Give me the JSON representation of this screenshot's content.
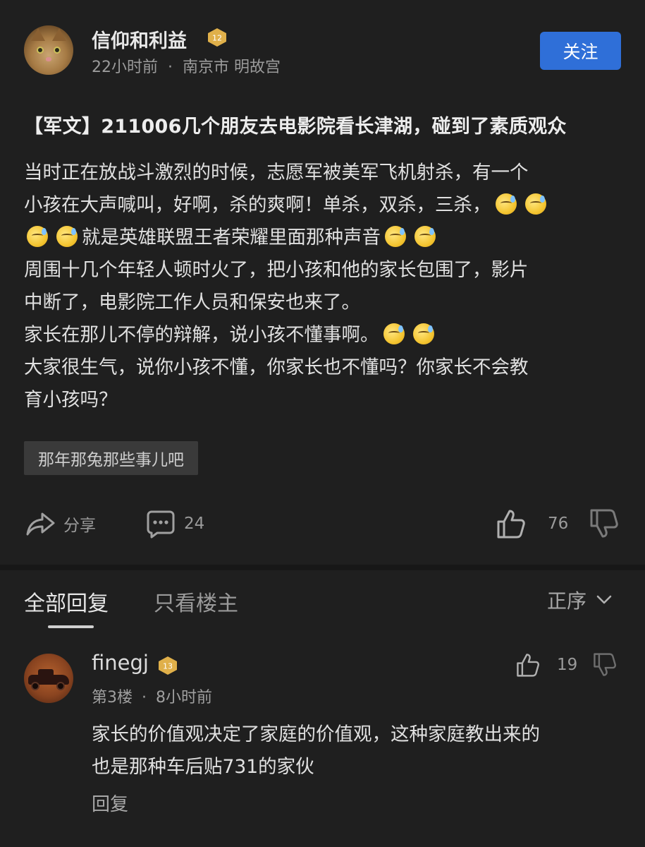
{
  "post": {
    "author": "信仰和利益",
    "author_level": "12",
    "time_ago": "22小时前",
    "separator": "·",
    "location": "南京市 明故宫",
    "follow_label": "关注",
    "title": "【军文】211006几个朋友去电影院看长津湖，碰到了素质观众",
    "body": {
      "l1": "当时正在放战斗激烈的时候，志愿军被美军飞机射杀，有一个",
      "l2": "小孩在大声喊叫，好啊，杀的爽啊！单杀，双杀，三杀，",
      "l3": "就是英雄联盟王者荣耀里面那种声音",
      "l4": "周围十几个年轻人顿时火了，把小孩和他的家长包围了，影片",
      "l5": "中断了，电影院工作人员和保安也来了。",
      "l6": "家长在那儿不停的辩解，说小孩不懂事啊。",
      "l7": "大家很生气，说你小孩不懂，你家长也不懂吗？你家长不会教",
      "l8": "育小孩吗？"
    },
    "emoji_name": "sweat-emoji",
    "tag": "那年那兔那些事儿吧",
    "share_label": "分享",
    "comment_count": "24",
    "like_count": "76"
  },
  "comments_section": {
    "tab_all": "全部回复",
    "tab_op": "只看楼主",
    "sort_label": "正序",
    "comments": [
      {
        "author": "finegj",
        "level": "13",
        "floor": "第3楼",
        "separator": "·",
        "time_ago": "8小时前",
        "like_count": "19",
        "text_l1": "家长的价值观决定了家庭的价值观，这种家庭教出来的",
        "text_l2": "也是那种车后贴731的家伙",
        "reply_label": "回复"
      }
    ]
  },
  "colors": {
    "background": "#1f1f1f",
    "follow_button": "#2f6fd8",
    "level_badge": "#e0b04a",
    "tag_background": "#3a3a3a"
  }
}
